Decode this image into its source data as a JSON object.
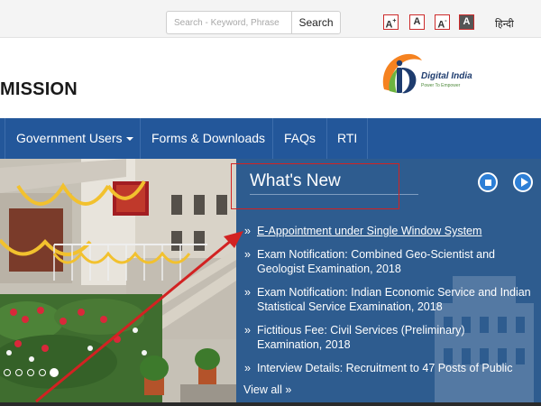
{
  "topbar": {
    "search_placeholder": "Search - Keyword, Phrase",
    "search_button": "Search",
    "font_sizes": [
      {
        "label": "A",
        "sup": "+"
      },
      {
        "label": "A",
        "sup": ""
      },
      {
        "label": "A",
        "sup": "-"
      },
      {
        "label": "A",
        "sup": ""
      }
    ],
    "language_link": "हिन्दी"
  },
  "header": {
    "title": "MISSION",
    "logo_name": "Digital India",
    "logo_tagline": "Power To Empower"
  },
  "nav": {
    "items": [
      "Government Users",
      "Forms & Downloads",
      "FAQs",
      "RTI"
    ]
  },
  "whats_new": {
    "title": "What's New",
    "items": [
      "E-Appointment under Single Window System",
      "Exam Notification: Combined Geo-Scientist and Geologist Examination, 2018",
      "Exam Notification: Indian Economic Service and Indian Statistical Service Examination, 2018",
      "Fictitious Fee: Civil Services (Preliminary) Examination, 2018",
      "Interview Details: Recruitment to 47 Posts of Public"
    ],
    "view_all": "View all »",
    "bullet": "»"
  },
  "slider": {
    "dot_count": 5,
    "active_index": 4
  },
  "colors": {
    "nav_bg": "#23579a",
    "panel_bg": "#2e5c8f",
    "annotation_red": "#d22222",
    "control_blue": "#2d7fd6"
  }
}
